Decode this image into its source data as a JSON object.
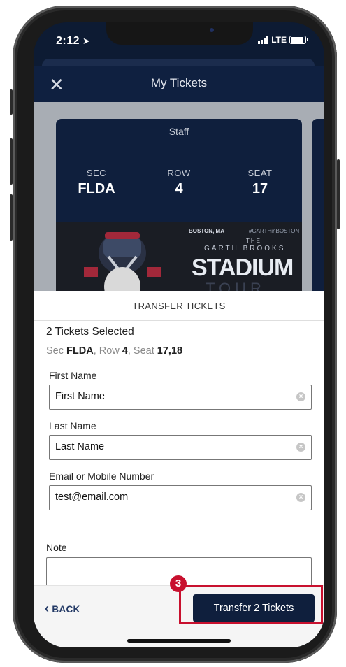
{
  "status_bar": {
    "time": "2:12",
    "location_arrow": "➤",
    "network": "LTE"
  },
  "header": {
    "title": "My Tickets",
    "close_glyph": "✕"
  },
  "ticket": {
    "type": "Staff",
    "sec_label": "SEC",
    "sec_value": "FLDA",
    "row_label": "ROW",
    "row_value": "4",
    "seat_label": "SEAT",
    "seat_value": "17",
    "banner": {
      "city": "BOSTON, MA",
      "hashtag": "#GARTHinBOSTON",
      "the": "THE",
      "artist": "GARTH BROOKS",
      "title": "STADIUM",
      "subtitle": "TOUR"
    }
  },
  "sheet": {
    "title": "TRANSFER TICKETS",
    "selected": "2 Tickets Selected",
    "seat_info": {
      "sec_prefix": "Sec ",
      "sec": "FLDA",
      "row_prefix": ", Row ",
      "row": "4",
      "seat_prefix": ", Seat ",
      "seats": "17,18"
    },
    "first_name": {
      "label": "First Name",
      "value": "First Name"
    },
    "last_name": {
      "label": "Last Name",
      "value": "Last Name"
    },
    "contact": {
      "label": "Email or Mobile Number",
      "value": "test@email.com"
    },
    "note": {
      "label": "Note",
      "value": ""
    }
  },
  "footer": {
    "back_label": "BACK",
    "back_glyph": "‹",
    "transfer_label": "Transfer 2 Tickets"
  },
  "annotation": {
    "step": "3",
    "color": "#c8102e"
  },
  "colors": {
    "navy": "#0f2040",
    "button": "#0f1f3d",
    "link": "#243a66"
  }
}
